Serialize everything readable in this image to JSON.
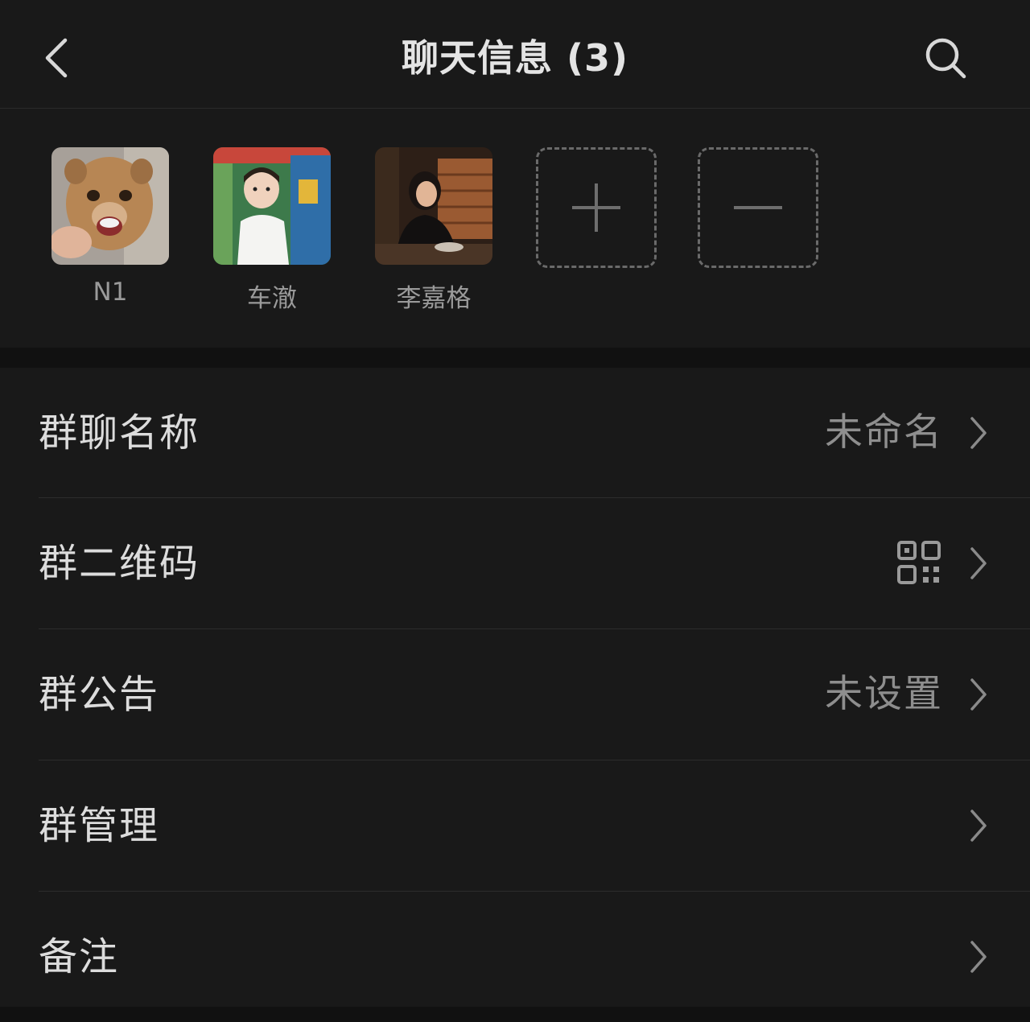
{
  "header": {
    "title": "聊天信息 (3)",
    "back_icon": "chevron-left-icon",
    "search_icon": "search-icon"
  },
  "members": [
    {
      "name": "N1",
      "avatar": "lion-cub-photo"
    },
    {
      "name": "车澈",
      "avatar": "toddler-photo"
    },
    {
      "name": "李嘉格",
      "avatar": "woman-restaurant-photo"
    }
  ],
  "member_actions": {
    "add_icon": "plus-icon",
    "remove_icon": "minus-icon"
  },
  "settings": [
    {
      "label": "群聊名称",
      "value": "未命名"
    },
    {
      "label": "群二维码",
      "value": "",
      "icon": "qr-code-icon"
    },
    {
      "label": "群公告",
      "value": "未设置"
    },
    {
      "label": "群管理",
      "value": ""
    },
    {
      "label": "备注",
      "value": ""
    }
  ],
  "colors": {
    "background": "#111111",
    "panel": "#191919",
    "text_primary": "#dcdcdc",
    "text_secondary": "#8e8e8e"
  }
}
